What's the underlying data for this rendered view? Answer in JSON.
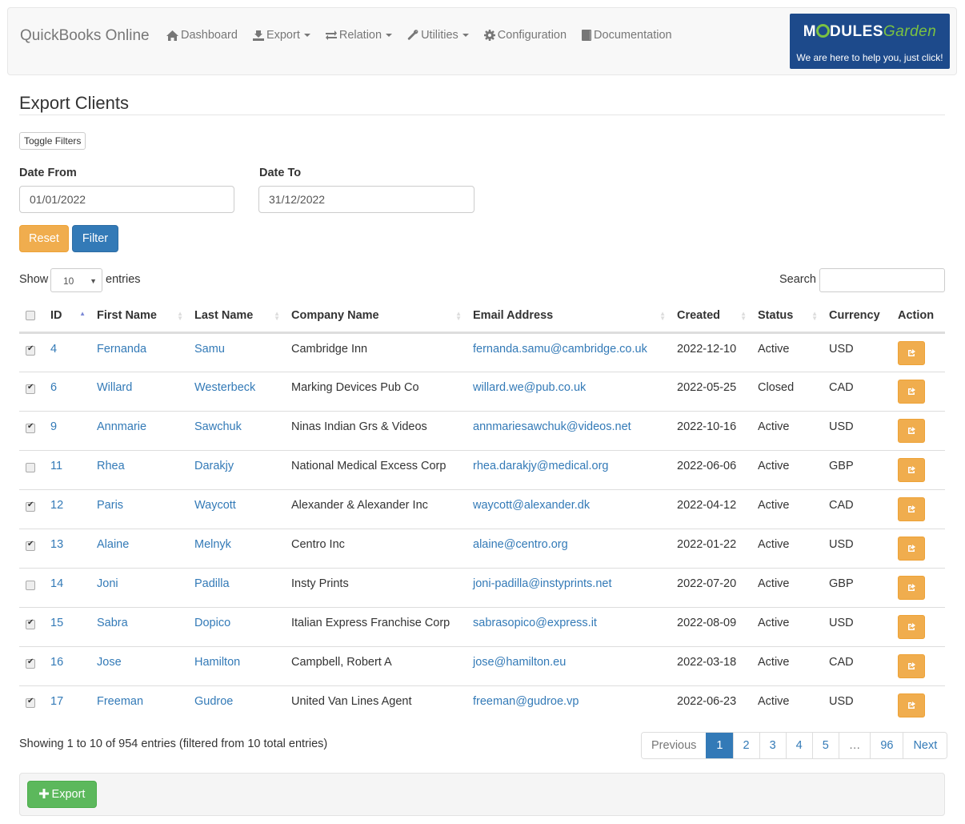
{
  "navbar": {
    "brand": "QuickBooks Online",
    "items": [
      {
        "label": "Dashboard",
        "icon": "home-icon",
        "dropdown": false
      },
      {
        "label": "Export",
        "icon": "export-icon",
        "dropdown": true
      },
      {
        "label": "Relation",
        "icon": "exchange-icon",
        "dropdown": true
      },
      {
        "label": "Utilities",
        "icon": "wrench-icon",
        "dropdown": true
      },
      {
        "label": "Configuration",
        "icon": "gear-icon",
        "dropdown": false
      },
      {
        "label": "Documentation",
        "icon": "book-icon",
        "dropdown": false
      }
    ],
    "logo": {
      "title_a": "M",
      "title_b": "DULES",
      "title_c": "Garden",
      "tagline": "We are here to help you, just click!"
    }
  },
  "page": {
    "title": "Export Clients",
    "toggle_filters": "Toggle Filters"
  },
  "filters": {
    "date_from_label": "Date From",
    "date_from_value": "01/01/2022",
    "date_to_label": "Date To",
    "date_to_value": "31/12/2022",
    "reset_label": "Reset",
    "filter_label": "Filter"
  },
  "table_controls": {
    "show_label": "Show",
    "page_length": "10",
    "entries_label": "entries",
    "search_label": "Search",
    "search_value": ""
  },
  "table": {
    "columns": [
      "ID",
      "First Name",
      "Last Name",
      "Company Name",
      "Email Address",
      "Created",
      "Status",
      "Currency",
      "Action"
    ],
    "rows": [
      {
        "checked": true,
        "id": "4",
        "first": "Fernanda",
        "last": "Samu",
        "company": "Cambridge Inn",
        "email": "fernanda.samu@cambridge.co.uk",
        "created": "2022-12-10",
        "status": "Active",
        "currency": "USD"
      },
      {
        "checked": true,
        "id": "6",
        "first": "Willard",
        "last": "Westerbeck",
        "company": "Marking Devices Pub Co",
        "email": "willard.we@pub.co.uk",
        "created": "2022-05-25",
        "status": "Closed",
        "currency": "CAD"
      },
      {
        "checked": true,
        "id": "9",
        "first": "Annmarie",
        "last": "Sawchuk",
        "company": "Ninas Indian Grs & Videos",
        "email": "annmariesawchuk@videos.net",
        "created": "2022-10-16",
        "status": "Active",
        "currency": "USD"
      },
      {
        "checked": false,
        "id": "11",
        "first": "Rhea",
        "last": "Darakjy",
        "company": "National Medical Excess Corp",
        "email": "rhea.darakjy@medical.org",
        "created": "2022-06-06",
        "status": "Active",
        "currency": "GBP"
      },
      {
        "checked": true,
        "id": "12",
        "first": "Paris",
        "last": "Waycott",
        "company": "Alexander & Alexander Inc",
        "email": "waycott@alexander.dk",
        "created": "2022-04-12",
        "status": "Active",
        "currency": "CAD"
      },
      {
        "checked": true,
        "id": "13",
        "first": "Alaine",
        "last": "Melnyk",
        "company": "Centro Inc",
        "email": "alaine@centro.org",
        "created": "2022-01-22",
        "status": "Active",
        "currency": "USD"
      },
      {
        "checked": false,
        "id": "14",
        "first": "Joni",
        "last": "Padilla",
        "company": "Insty Prints",
        "email": "joni-padilla@instyprints.net",
        "created": "2022-07-20",
        "status": "Active",
        "currency": "GBP"
      },
      {
        "checked": true,
        "id": "15",
        "first": "Sabra",
        "last": "Dopico",
        "company": "Italian Express Franchise Corp",
        "email": "sabrasopico@express.it",
        "created": "2022-08-09",
        "status": "Active",
        "currency": "USD"
      },
      {
        "checked": true,
        "id": "16",
        "first": "Jose",
        "last": "Hamilton",
        "company": "Campbell, Robert A",
        "email": "jose@hamilton.eu",
        "created": "2022-03-18",
        "status": "Active",
        "currency": "CAD"
      },
      {
        "checked": true,
        "id": "17",
        "first": "Freeman",
        "last": "Gudroe",
        "company": "United Van Lines Agent",
        "email": "freeman@gudroe.vp",
        "created": "2022-06-23",
        "status": "Active",
        "currency": "USD"
      }
    ]
  },
  "footer": {
    "info": "Showing 1 to 10 of 954 entries (filtered from 10 total entries)",
    "pagination": [
      "Previous",
      "1",
      "2",
      "3",
      "4",
      "5",
      "…",
      "96",
      "Next"
    ],
    "active_page": "1",
    "export_label": "Export"
  },
  "colors": {
    "primary": "#337ab7",
    "warning": "#f0ad4e",
    "success": "#5cb85c",
    "logo_bg": "#1d4a8b",
    "logo_accent": "#7bc241"
  }
}
